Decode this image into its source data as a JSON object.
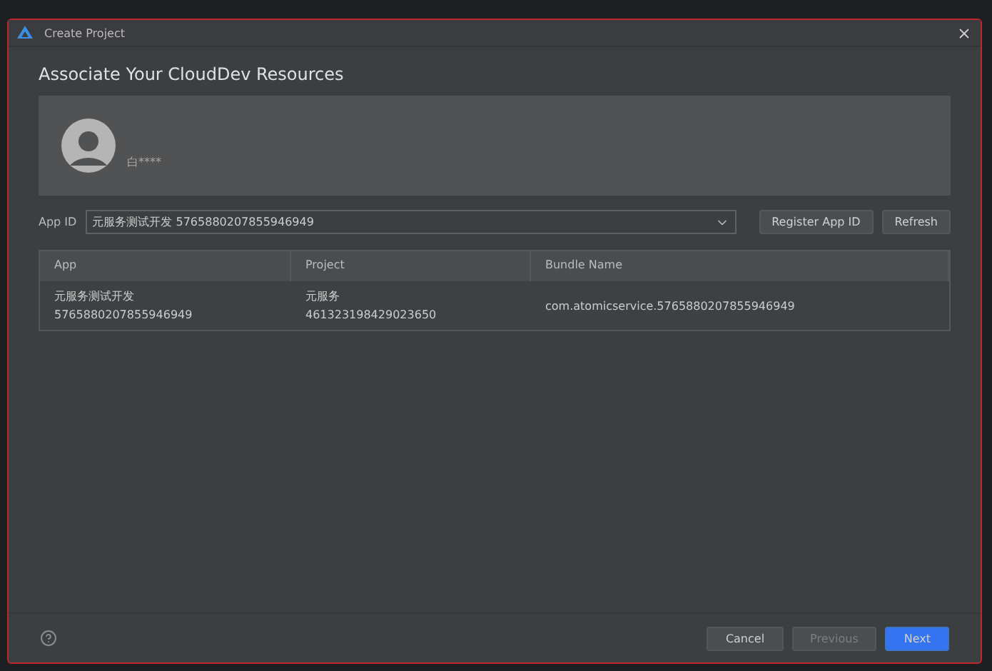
{
  "window": {
    "title": "Create Project"
  },
  "heading": "Associate Your CloudDev Resources",
  "account": {
    "name": "白****"
  },
  "app_id": {
    "label": "App ID",
    "value": "元服务测试开发 5765880207855946949"
  },
  "actions": [
    {
      "label": "Register App ID"
    },
    {
      "label": "Refresh"
    }
  ],
  "table": {
    "columns": [
      "App",
      "Project",
      "Bundle Name"
    ],
    "rows": [
      {
        "cells": [
          [
            "元服务测试开发",
            "5765880207855946949"
          ],
          [
            "元服务",
            "461323198429023650"
          ],
          [
            "com.atomicservice.5765880207855946949"
          ]
        ]
      }
    ]
  },
  "footer": [
    {
      "label": "Cancel",
      "kind": "normal",
      "disabled": false
    },
    {
      "label": "Previous",
      "kind": "normal",
      "disabled": true
    },
    {
      "label": "Next",
      "kind": "primary",
      "disabled": false
    }
  ]
}
